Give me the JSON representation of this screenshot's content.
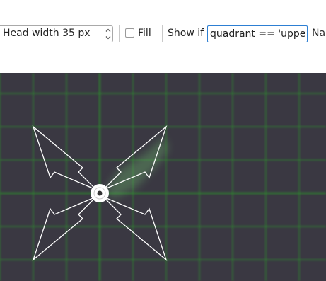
{
  "toolbar": {
    "head_width_value": "Head width 35 px",
    "fill_label": "Fill",
    "fill_checked": false,
    "show_if_label": "Show if",
    "show_if_value": "quadrant == 'upper r",
    "name_label": "Nar"
  },
  "canvas": {
    "background_color": "#3a3842",
    "grid_color": "#2f8a2f",
    "arrow_color": "#ffffff",
    "glow_color": "#6fbf6f",
    "shape": "four-way-move-arrows-icon"
  }
}
